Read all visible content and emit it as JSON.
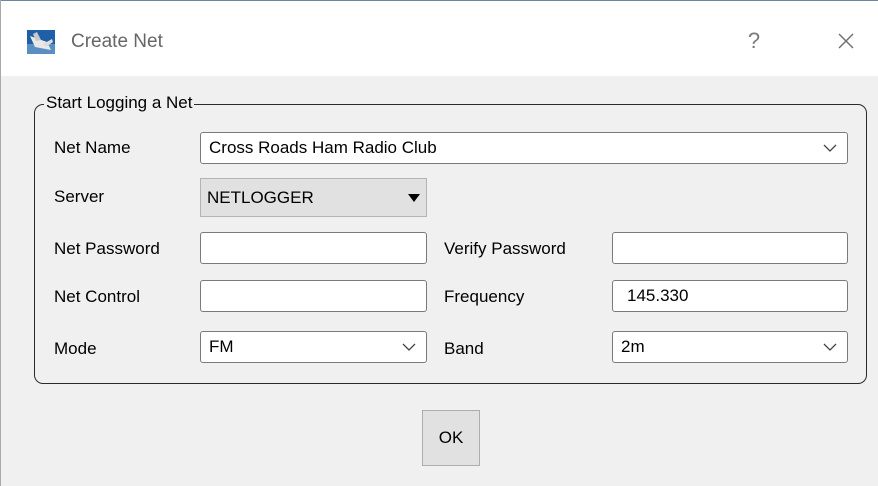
{
  "window": {
    "title": "Create Net",
    "help_label": "?"
  },
  "group": {
    "title": "Start Logging a Net"
  },
  "form": {
    "net_name": {
      "label": "Net Name",
      "value": "Cross Roads Ham Radio Club"
    },
    "server": {
      "label": "Server",
      "value": "NETLOGGER"
    },
    "net_password": {
      "label": "Net Password",
      "value": ""
    },
    "verify_password": {
      "label": "Verify Password",
      "value": ""
    },
    "net_control": {
      "label": "Net Control",
      "value": ""
    },
    "frequency": {
      "label": "Frequency",
      "value": "145.330"
    },
    "mode": {
      "label": "Mode",
      "value": "FM"
    },
    "band": {
      "label": "Band",
      "value": "2m"
    }
  },
  "buttons": {
    "ok_label": "OK"
  },
  "icons": {
    "app": "app-icon",
    "close": "close-icon",
    "dropdown": "chevron-down-icon",
    "server_dropdown": "triangle-down-icon"
  }
}
